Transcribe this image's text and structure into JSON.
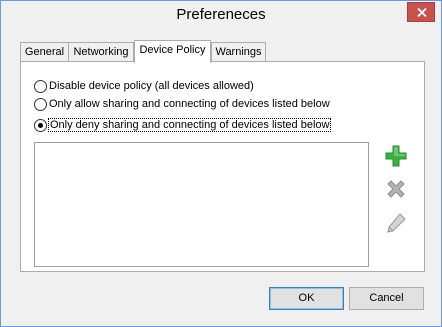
{
  "window": {
    "title": "Prefereneces"
  },
  "tabs": [
    {
      "label": "General"
    },
    {
      "label": "Networking"
    },
    {
      "label": "Device Policy"
    },
    {
      "label": "Warnings"
    }
  ],
  "active_tab": "Device Policy",
  "policy": {
    "options": [
      {
        "label": "Disable device policy (all devices allowed)",
        "checked": false
      },
      {
        "label": "Only allow sharing and connecting of devices listed below",
        "checked": false
      },
      {
        "label": "Only deny sharing and connecting of devices listed below",
        "checked": true
      }
    ],
    "devices": []
  },
  "icons": {
    "add": "plus-icon",
    "remove": "x-icon",
    "edit": "pencil-icon",
    "close": "close-icon"
  },
  "colors": {
    "add_green": "#3cb043",
    "disabled_gray": "#a8a8a8",
    "close_red": "#c75050"
  },
  "buttons": {
    "ok_label": "OK",
    "cancel_label": "Cancel"
  }
}
